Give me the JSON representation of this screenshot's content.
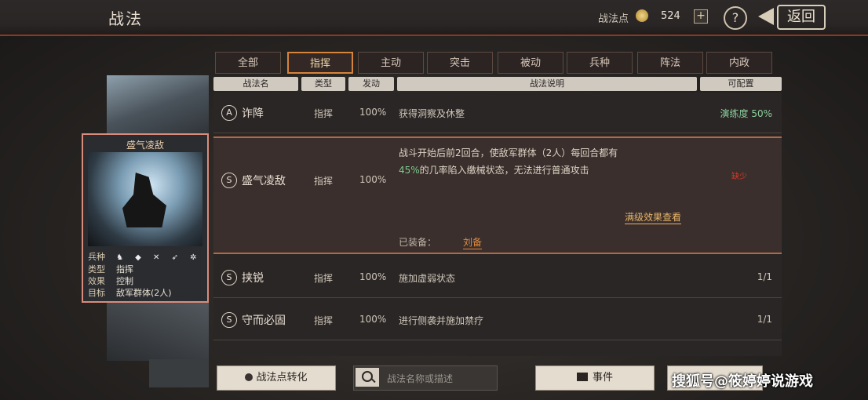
{
  "header": {
    "title": "战法",
    "resource_label": "战法点",
    "resource_value": "524",
    "plus": "+",
    "help": "?",
    "back_label": "返回"
  },
  "card": {
    "title": "盛气凌敌",
    "rows": [
      {
        "k": "兵种",
        "v": ""
      },
      {
        "k": "类型",
        "v": "指挥"
      },
      {
        "k": "效果",
        "v": "控制"
      },
      {
        "k": "目标",
        "v": "敌军群体(2人)"
      }
    ],
    "troop_icons": "♞ ◆ ✕ ➶ ✲"
  },
  "tabs": [
    "全部",
    "指挥",
    "主动",
    "突击",
    "被动",
    "兵种",
    "阵法",
    "内政"
  ],
  "active_tab": 1,
  "table": {
    "headers": [
      "战法名",
      "类型",
      "发动",
      "战法说明",
      "可配置"
    ],
    "rows": [
      {
        "grade": "A",
        "name": "诈降",
        "type": "指挥",
        "rate": "100%",
        "desc": "获得洞察及休整",
        "cfg": "演练度 50%"
      },
      {
        "grade": "S",
        "name": "盛气凌敌",
        "type": "指挥",
        "rate": "100%",
        "desc_line1": "战斗开始后前2回合，使敌军群体（2人）每回合都有",
        "desc_hl": "45%",
        "desc_line2": "的几率陷入缴械状态，无法进行普通攻击",
        "flag": "缺少",
        "link": "满级效果查看",
        "owner_label": "已装备：",
        "owner": "刘备"
      },
      {
        "grade": "S",
        "name": "挟锐",
        "type": "指挥",
        "rate": "100%",
        "desc": "施加虚弱状态",
        "cfg": "1/1"
      },
      {
        "grade": "S",
        "name": "守而必固",
        "type": "指挥",
        "rate": "100%",
        "desc": "进行侧袭并施加禁疗",
        "cfg": "1/1"
      }
    ]
  },
  "bottom": {
    "convert_label": "战法点转化",
    "search_placeholder": "战法名称或描述",
    "event_label": "事件"
  },
  "watermark": "搜狐号@筱婷婷说游戏"
}
